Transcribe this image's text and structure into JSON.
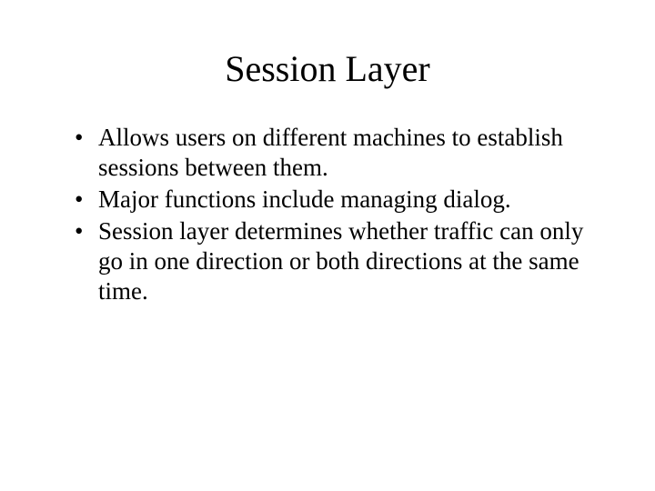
{
  "slide": {
    "title": "Session Layer",
    "bullets": [
      "Allows users on different machines to establish sessions between them.",
      "Major functions include managing dialog.",
      "Session layer determines whether traffic can only go in one direction or both directions at the same time."
    ]
  }
}
